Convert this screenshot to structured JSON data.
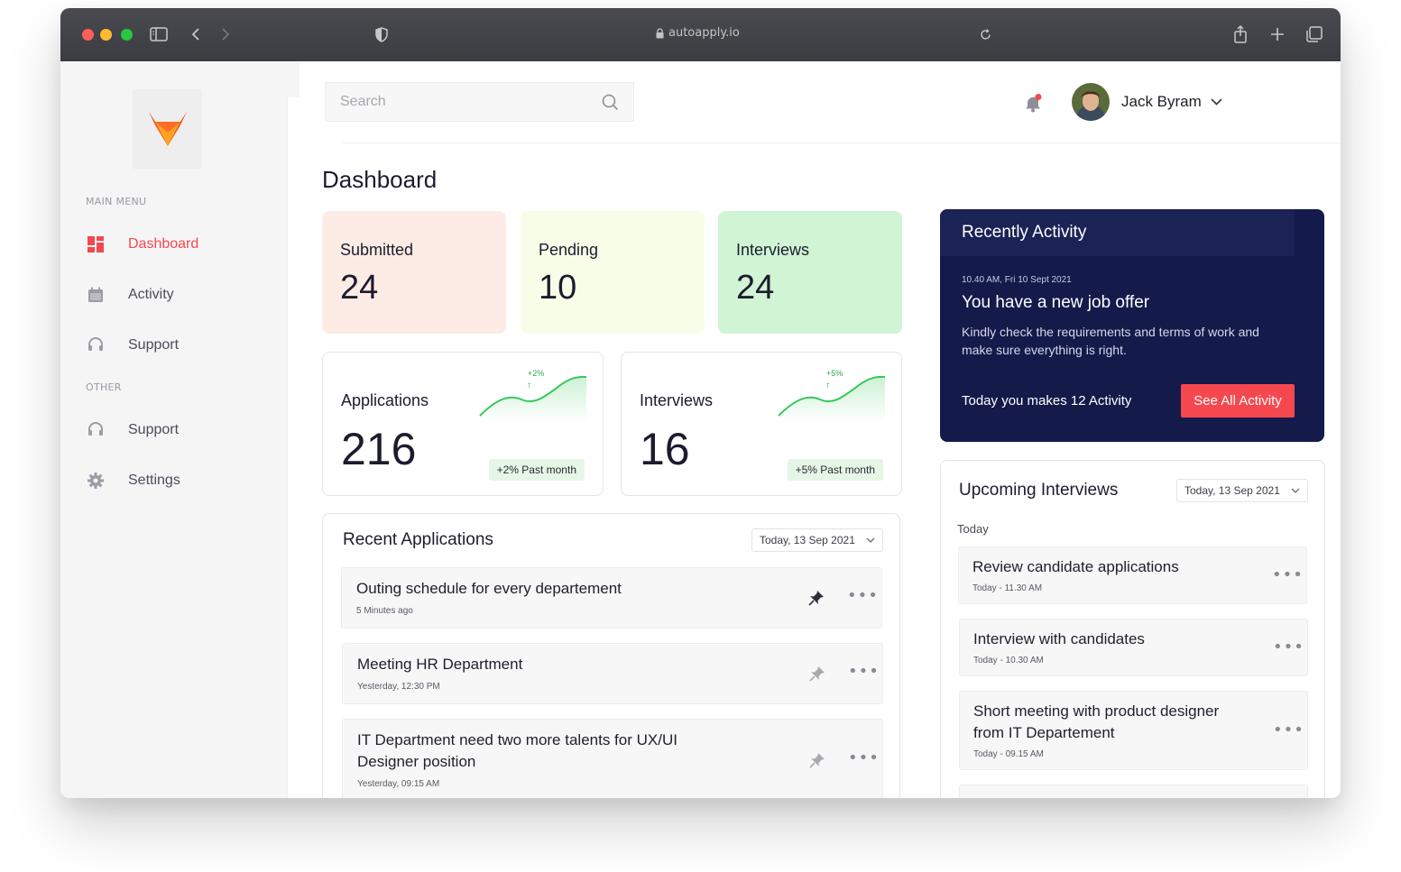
{
  "browser": {
    "url": "autoapply.io"
  },
  "sidebar": {
    "main_menu_heading": "MAIN MENU",
    "other_heading": "OTHER",
    "items": [
      {
        "label": "Dashboard",
        "icon": "dashboard-icon",
        "active": true
      },
      {
        "label": "Activity",
        "icon": "calendar-icon"
      },
      {
        "label": "Support",
        "icon": "headset-icon"
      }
    ],
    "other_items": [
      {
        "label": "Support",
        "icon": "headset-icon"
      },
      {
        "label": "Settings",
        "icon": "gear-icon"
      }
    ]
  },
  "header": {
    "search_placeholder": "Search",
    "user_name": "Jack Byram"
  },
  "page": {
    "title": "Dashboard"
  },
  "stats": [
    {
      "label": "Submitted",
      "value": "24",
      "color": "#fdece6"
    },
    {
      "label": "Pending",
      "value": "10",
      "color": "#f8fde8"
    },
    {
      "label": "Interviews",
      "value": "24",
      "color": "#d0f4d4"
    }
  ],
  "metrics": [
    {
      "label": "Applications",
      "value": "216",
      "change": "+2%",
      "pill": "+2% Past month"
    },
    {
      "label": "Interviews",
      "value": "16",
      "change": "+5%",
      "pill": "+5% Past month"
    }
  ],
  "recent_applications": {
    "title": "Recent Applications",
    "date": "Today, 13 Sep 2021",
    "items": [
      {
        "title": "Outing schedule for every departement",
        "time": "5 Minutes ago"
      },
      {
        "title": "Meeting HR Department",
        "time": "Yesterday, 12:30 PM"
      },
      {
        "title": "IT Department need two more talents for UX/UI Designer position",
        "time": "Yesterday, 09:15 AM"
      }
    ]
  },
  "activity": {
    "title": "Recently Activity",
    "time": "10.40 AM, Fri 10 Sept 2021",
    "headline": "You have a new job offer",
    "description": "Kindly check the requirements and terms of work and make sure everything is right.",
    "footer": "Today you makes 12 Activity",
    "button": "See All Activity"
  },
  "upcoming": {
    "title": "Upcoming Interviews",
    "date": "Today, 13 Sep 2021",
    "day_label": "Today",
    "items": [
      {
        "title": "Review candidate applications",
        "time": "Today - 11.30 AM"
      },
      {
        "title": "Interview with candidates",
        "time": "Today - 10.30 AM"
      },
      {
        "title": "Short meeting with product designer from IT Departement",
        "time": "Today - 09.15 AM"
      }
    ]
  },
  "colors": {
    "accent": "#f5484e",
    "navy": "#141a4a"
  }
}
